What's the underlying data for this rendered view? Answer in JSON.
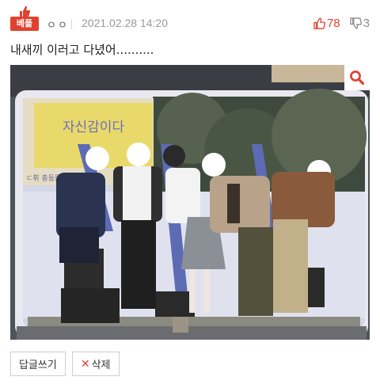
{
  "post": {
    "badge_label": "베플",
    "author": "ㅇㅇ",
    "date": "2021.02.28 14:20",
    "upvotes": "78",
    "downvotes": "3",
    "text": "내새끼 이러고 다녔어..........",
    "photo_sign_text": "자신감이다",
    "photo_banner_text": "ㄷ휘 총동문회"
  },
  "actions": {
    "reply_label": "답글쓰기",
    "delete_label": "삭제"
  },
  "colors": {
    "accent": "#e0412f",
    "muted": "#9a9a9a"
  },
  "icons": {
    "badge": "thumbs-up-icon",
    "upvote": "thumbs-up-icon",
    "downvote": "thumbs-down-icon",
    "zoom": "search-icon",
    "delete": "x-icon"
  }
}
